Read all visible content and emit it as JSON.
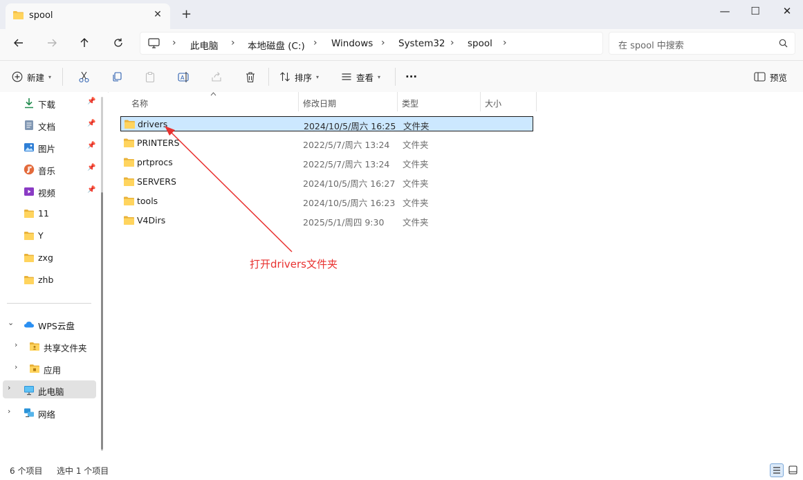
{
  "window": {
    "tab_title": "spool",
    "minimize_glyph": "—",
    "maximize_glyph": "☐",
    "close_glyph": "✕",
    "tab_close_glyph": "✕",
    "new_tab_glyph": "+"
  },
  "address": {
    "breadcrumbs": [
      "此电脑",
      "本地磁盘 (C:)",
      "Windows",
      "System32",
      "spool"
    ],
    "search_placeholder": "在 spool 中搜索"
  },
  "toolbar": {
    "new_label": "新建",
    "sort_label": "排序",
    "view_label": "查看",
    "more_label": "···",
    "preview_label": "预览"
  },
  "sidebar": {
    "quick": [
      {
        "label": "下载",
        "icon": "download-icon",
        "pinned": true
      },
      {
        "label": "文档",
        "icon": "document-icon",
        "pinned": true
      },
      {
        "label": "图片",
        "icon": "picture-icon",
        "pinned": true
      },
      {
        "label": "音乐",
        "icon": "music-icon",
        "pinned": true
      },
      {
        "label": "视频",
        "icon": "video-icon",
        "pinned": true
      },
      {
        "label": "11",
        "icon": "folder-icon",
        "pinned": false
      },
      {
        "label": "Y",
        "icon": "folder-icon",
        "pinned": false
      },
      {
        "label": "zxg",
        "icon": "folder-icon",
        "pinned": false
      },
      {
        "label": "zhb",
        "icon": "folder-icon",
        "pinned": false
      }
    ],
    "wps": "WPS云盘",
    "shared": "共享文件夹",
    "apps": "应用",
    "thispc": "此电脑",
    "network": "网络"
  },
  "columns": {
    "name": "名称",
    "date": "修改日期",
    "type": "类型",
    "size": "大小"
  },
  "files": [
    {
      "name": "drivers",
      "date": "2024/10/5/周六 16:25",
      "type": "文件夹"
    },
    {
      "name": "PRINTERS",
      "date": "2022/5/7/周六 13:24",
      "type": "文件夹"
    },
    {
      "name": "prtprocs",
      "date": "2022/5/7/周六 13:24",
      "type": "文件夹"
    },
    {
      "name": "SERVERS",
      "date": "2024/10/5/周六 16:27",
      "type": "文件夹"
    },
    {
      "name": "tools",
      "date": "2024/10/5/周六 16:23",
      "type": "文件夹"
    },
    {
      "name": "V4Dirs",
      "date": "2025/5/1/周四 9:30",
      "type": "文件夹"
    }
  ],
  "annotation": "打开drivers文件夹",
  "status": {
    "count": "6 个项目",
    "selected": "选中 1 个项目"
  },
  "colors": {
    "accent": "#0067c0",
    "selection": "#cce8ff",
    "folder": "#f4c04a",
    "annotation": "#e8312f"
  }
}
